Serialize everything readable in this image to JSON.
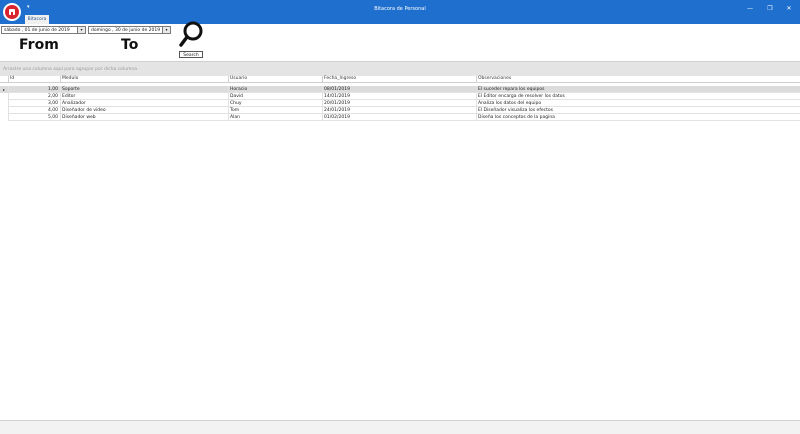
{
  "window": {
    "title": "Bitacora de Personal",
    "quick_access": "▾",
    "minimize": "—",
    "restore": "❐",
    "close": "✕"
  },
  "ribbon": {
    "tab": "Bitacora"
  },
  "filters": {
    "from_date": "sábado , 01 de    junio    de 2019",
    "to_date": "domingo , 30 de    junio    de 2019",
    "dropdown_glyph": "▾",
    "from_label": "From",
    "to_label": "To",
    "search_label": "Search"
  },
  "grid": {
    "group_hint": "Arrastre una columna aquí para agrupar por dicha columna",
    "columns": [
      "Id",
      "Medulo",
      "Usuario",
      "Fecha_Ingreso",
      "Observaciones"
    ],
    "selected_indicator": "▸",
    "rows": [
      {
        "id": "1,00",
        "modulo": "Soporte",
        "usuario": "Horacio",
        "fecha": "08/01/2019",
        "obs": "El suceder repara los equipos"
      },
      {
        "id": "2,00",
        "modulo": "Editor",
        "usuario": "David",
        "fecha": "14/01/2019",
        "obs": "El Editor encarga de resolver los datos"
      },
      {
        "id": "3,00",
        "modulo": "Analizador",
        "usuario": "Chuy",
        "fecha": "20/01/2019",
        "obs": "Analiza los datos del equipo"
      },
      {
        "id": "4,00",
        "modulo": "Diseñador de video",
        "usuario": "Tom",
        "fecha": "24/01/2019",
        "obs": "El Diseñador visualiza los efectos"
      },
      {
        "id": "5,00",
        "modulo": "Diseñador web",
        "usuario": "Alan",
        "fecha": "01/02/2019",
        "obs": "Diseña los conceptos de la pagina"
      }
    ]
  }
}
